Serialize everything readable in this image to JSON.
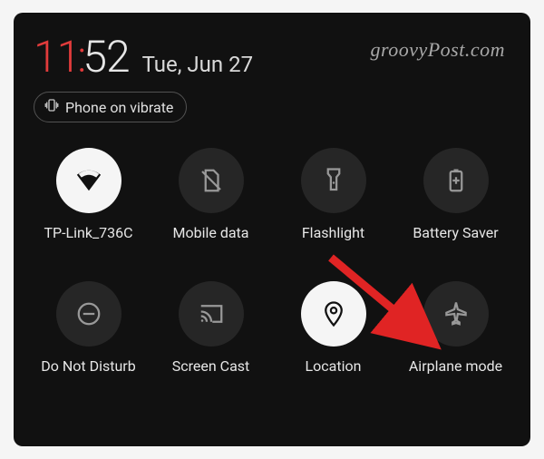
{
  "time": {
    "hour": "11",
    "minute": "52"
  },
  "date": "Tue, Jun 27",
  "watermark": "groovyPost.com",
  "status_chip": {
    "label": "Phone on vibrate"
  },
  "tiles": [
    {
      "label": "TP-Link_736C",
      "icon": "wifi-icon",
      "active": true
    },
    {
      "label": "Mobile data",
      "icon": "no-sim-icon",
      "active": false
    },
    {
      "label": "Flashlight",
      "icon": "flashlight-icon",
      "active": false
    },
    {
      "label": "Battery Saver",
      "icon": "battery-plus-icon",
      "active": false
    },
    {
      "label": "Do Not Disturb",
      "icon": "dnd-icon",
      "active": false
    },
    {
      "label": "Screen Cast",
      "icon": "cast-icon",
      "active": false
    },
    {
      "label": "Location",
      "icon": "location-icon",
      "active": true
    },
    {
      "label": "Airplane mode",
      "icon": "airplane-icon",
      "active": false
    }
  ],
  "annotation": {
    "arrow_color": "#e02424",
    "target_tile": "Airplane mode"
  }
}
